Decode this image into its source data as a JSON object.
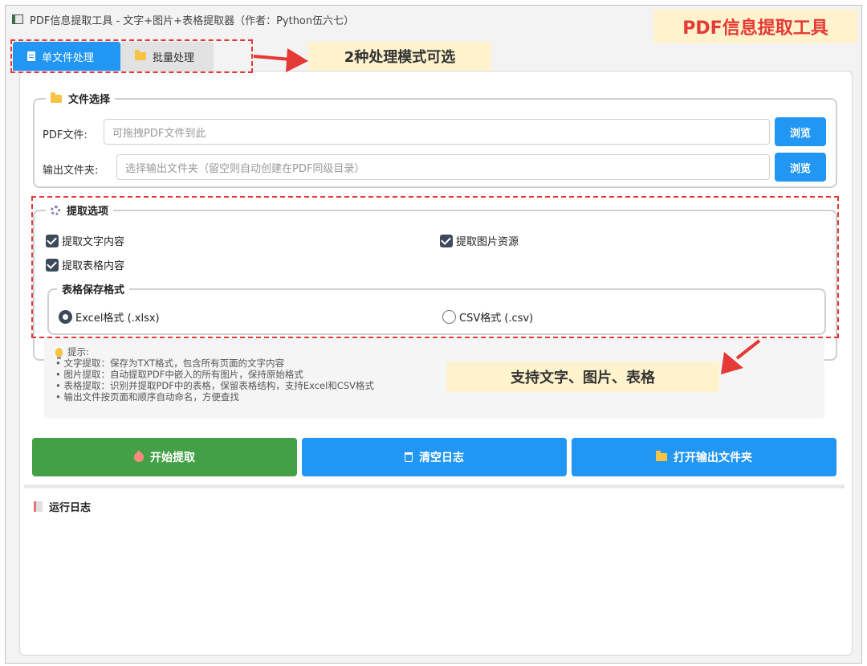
{
  "window": {
    "title": "PDF信息提取工具 - 文字+图片+表格提取器（作者：Python伍六七）"
  },
  "tabs": [
    {
      "label": "单文件处理",
      "icon": "document-icon",
      "active": true
    },
    {
      "label": "批量处理",
      "icon": "folder-icon",
      "active": false
    }
  ],
  "file_select": {
    "title": "文件选择",
    "pdf_label": "PDF文件:",
    "pdf_placeholder": "可拖拽PDF文件到此",
    "output_label": "输出文件夹:",
    "output_placeholder": "选择输出文件夹（留空则自动创建在PDF同级目录）",
    "browse_label": "浏览"
  },
  "options": {
    "title": "提取选项",
    "extract_text": "提取文字内容",
    "extract_images": "提取图片资源",
    "extract_tables": "提取表格内容",
    "format_title": "表格保存格式",
    "excel_label": "Excel格式 (.xlsx)",
    "csv_label": "CSV格式 (.csv)",
    "selected_format": "excel"
  },
  "tips": {
    "title": "提示:",
    "lines": [
      "• 文字提取：保存为TXT格式，包含所有页面的文字内容",
      "• 图片提取：自动提取PDF中嵌入的所有图片，保持原始格式",
      "• 表格提取：识别并提取PDF中的表格，保留表格结构，支持Excel和CSV格式",
      "• 输出文件按页面和顺序自动命名，方便查找"
    ]
  },
  "actions": {
    "start_label": "开始提取",
    "clear_label": "清空日志",
    "open_label": "打开输出文件夹"
  },
  "log": {
    "title": "运行日志"
  },
  "annotations": {
    "app_title": "PDF信息提取工具",
    "modes_note": "2种处理模式可选",
    "support_note": "支持文字、图片、表格"
  },
  "colors": {
    "primary": "#2196f3",
    "success": "#43a047",
    "annotation_red": "#e53935",
    "callout_bg": "#fff3cd"
  }
}
